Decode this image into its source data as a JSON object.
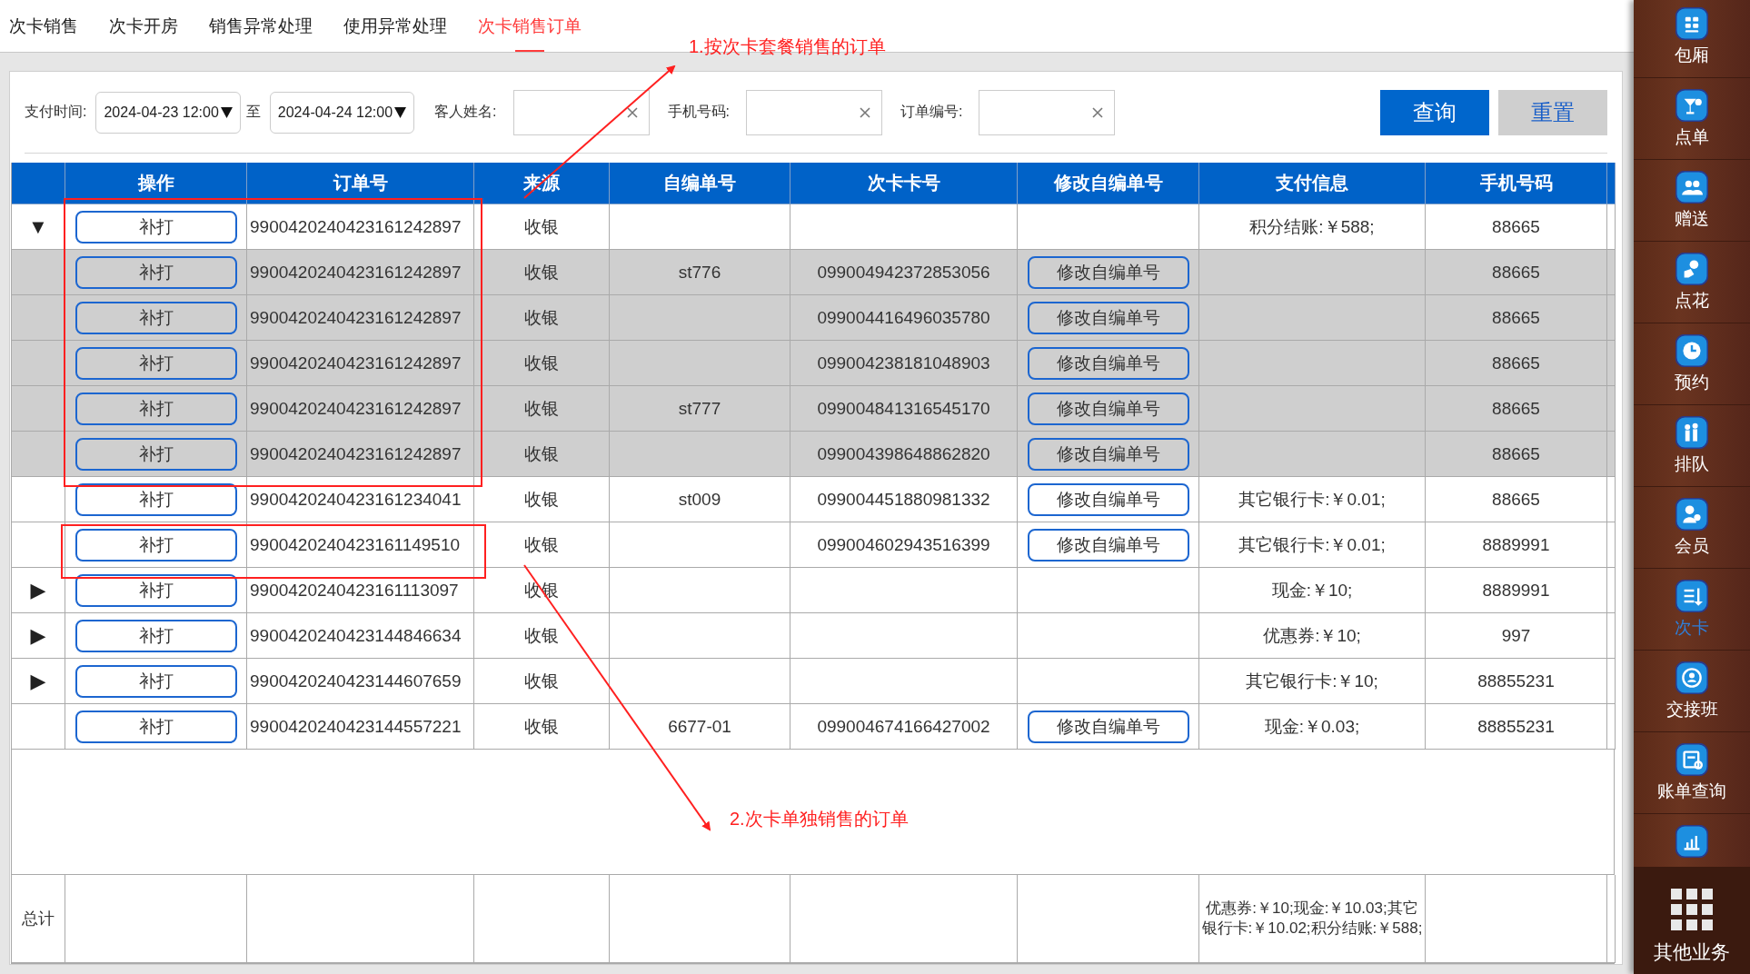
{
  "tabs": [
    {
      "label": "次卡销售",
      "selected": false
    },
    {
      "label": "次卡开房",
      "selected": false
    },
    {
      "label": "销售异常处理",
      "selected": false
    },
    {
      "label": "使用异常处理",
      "selected": false
    },
    {
      "label": "次卡销售订单",
      "selected": true
    }
  ],
  "filters": {
    "pay_time": {
      "label": "支付时间:",
      "from": "2024-04-23 12:00",
      "separator": "至",
      "to": "2024-04-24 12:00"
    },
    "fields": [
      {
        "label": "客人姓名:"
      },
      {
        "label": "手机号码:"
      },
      {
        "label": "订单编号:"
      }
    ],
    "query_button": "查询",
    "reset_button": "重置"
  },
  "table": {
    "columns": [
      "",
      "操作",
      "订单号",
      "来源",
      "自编单号",
      "次卡卡号",
      "修改自编单号",
      "支付信息",
      "手机号码"
    ],
    "rows": [
      {
        "kind": "main",
        "toggle": "▼",
        "print_button": "补打",
        "order_no": "9900420240423161242897",
        "source": "收银",
        "payment": "积分结账:￥588;",
        "phone": "88665"
      },
      {
        "kind": "child",
        "print_button": "补打",
        "order_no": "9900420240423161242897",
        "source": "收银",
        "self_no": "st776",
        "card_no": "099004942372853056",
        "edit_button": "修改自编单号",
        "phone": "88665"
      },
      {
        "kind": "child",
        "print_button": "补打",
        "order_no": "9900420240423161242897",
        "source": "收银",
        "card_no": "099004416496035780",
        "edit_button": "修改自编单号",
        "phone": "88665"
      },
      {
        "kind": "child",
        "print_button": "补打",
        "order_no": "9900420240423161242897",
        "source": "收银",
        "card_no": "099004238181048903",
        "edit_button": "修改自编单号",
        "phone": "88665"
      },
      {
        "kind": "child",
        "print_button": "补打",
        "order_no": "9900420240423161242897",
        "source": "收银",
        "self_no": "st777",
        "card_no": "099004841316545170",
        "edit_button": "修改自编单号",
        "phone": "88665"
      },
      {
        "kind": "child",
        "print_button": "补打",
        "order_no": "9900420240423161242897",
        "source": "收银",
        "card_no": "099004398648862820",
        "edit_button": "修改自编单号",
        "phone": "88665"
      },
      {
        "kind": "main",
        "print_button": "补打",
        "order_no": "9900420240423161234041",
        "source": "收银",
        "self_no": "st009",
        "card_no": "099004451880981332",
        "edit_button": "修改自编单号",
        "payment": "其它银行卡:￥0.01;",
        "phone": "88665"
      },
      {
        "kind": "main",
        "print_button": "补打",
        "order_no": "9900420240423161149510",
        "source": "收银",
        "card_no": "099004602943516399",
        "edit_button": "修改自编单号",
        "payment": "其它银行卡:￥0.01;",
        "phone": "8889991"
      },
      {
        "kind": "main",
        "toggle": "▶",
        "print_button": "补打",
        "order_no": "9900420240423161113097",
        "source": "收银",
        "payment": "现金:￥10;",
        "phone": "8889991"
      },
      {
        "kind": "main",
        "toggle": "▶",
        "print_button": "补打",
        "order_no": "9900420240423144846634",
        "source": "收银",
        "payment": "优惠券:￥10;",
        "phone": "997"
      },
      {
        "kind": "main",
        "toggle": "▶",
        "print_button": "补打",
        "order_no": "9900420240423144607659",
        "source": "收银",
        "payment": "其它银行卡:￥10;",
        "phone": "88855231"
      },
      {
        "kind": "main",
        "print_button": "补打",
        "order_no": "9900420240423144557221",
        "source": "收银",
        "self_no": "6677-01",
        "card_no": "099004674166427002",
        "edit_button": "修改自编单号",
        "payment": "现金:￥0.03;",
        "phone": "88855231"
      }
    ],
    "total": {
      "label": "总计",
      "payment": "优惠券:￥10;现金:￥10.03;其它银行卡:￥10.02;积分结账:￥588;"
    }
  },
  "annotations": [
    {
      "text": "1.按次卡套餐销售的订单"
    },
    {
      "text": "2.次卡单独销售的订单"
    }
  ],
  "sidebar": {
    "items": [
      {
        "label": "包厢",
        "selected": false
      },
      {
        "label": "点单",
        "selected": false
      },
      {
        "label": "赠送",
        "selected": false
      },
      {
        "label": "点花",
        "selected": false
      },
      {
        "label": "预约",
        "selected": false
      },
      {
        "label": "排队",
        "selected": false
      },
      {
        "label": "会员",
        "selected": false
      },
      {
        "label": "次卡",
        "selected": true
      },
      {
        "label": "交接班",
        "selected": false
      },
      {
        "label": "账单查询",
        "selected": false
      },
      {
        "selected": false
      }
    ],
    "more": "其他业务"
  }
}
